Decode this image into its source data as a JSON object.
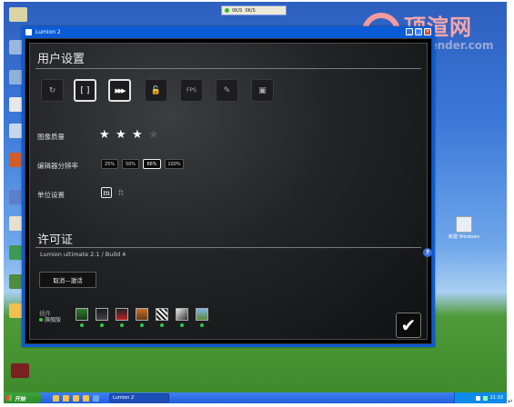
{
  "desktop": {
    "top_tray": {
      "items": [
        "0K/S",
        "0K/S"
      ]
    },
    "watermark": {
      "title": "顶渲网",
      "url": "toprender.com"
    },
    "right_icon_label": "新建 Windows"
  },
  "window": {
    "title": "Lumion 2",
    "controls": [
      "_",
      "□",
      "×"
    ]
  },
  "user_settings": {
    "title": "用户设置",
    "tools": [
      {
        "name": "mouse-invert-icon",
        "glyph": "↻",
        "selected": false
      },
      {
        "name": "fullscreen-icon",
        "glyph": "[ ]",
        "selected": true
      },
      {
        "name": "fast-forward-icon",
        "glyph": "▶▶▶",
        "selected": true
      },
      {
        "name": "lock-icon",
        "glyph": "🔓",
        "selected": false
      },
      {
        "name": "fps-icon",
        "glyph": "FPS",
        "selected": false
      },
      {
        "name": "edit-icon",
        "glyph": "✎",
        "selected": false
      },
      {
        "name": "memory-icon",
        "glyph": "▣",
        "selected": false
      }
    ],
    "image_quality_label": "图像质量",
    "image_quality_stars": 3,
    "image_quality_max": 4,
    "resolution_label": "编辑器分辨率",
    "resolution_options": [
      "25%",
      "50%",
      "66%",
      "100%"
    ],
    "resolution_selected": "66%",
    "units_label": "单位设置",
    "units": [
      "m",
      "ft"
    ],
    "unit_selected": "m"
  },
  "license": {
    "title": "许可证",
    "version": "Lumion ultimate 2.1 / Build 4",
    "deactivate_button": "取消—激活",
    "help": "?",
    "plugins_label": "插件",
    "edition_label": "旗舰版",
    "plugin_names": [
      "tree-plugin-icon",
      "people-plugin-icon",
      "car-plugin-icon",
      "film-plugin-icon",
      "clapper-plugin-icon",
      "effects-plugin-icon",
      "landscape-plugin-icon"
    ]
  },
  "taskbar": {
    "start": "开始",
    "task": "Lumion 2",
    "clock": "21:33"
  },
  "colors": {
    "plugin_ok": "#2ecc40",
    "title_bar": "#0a5bd6"
  }
}
